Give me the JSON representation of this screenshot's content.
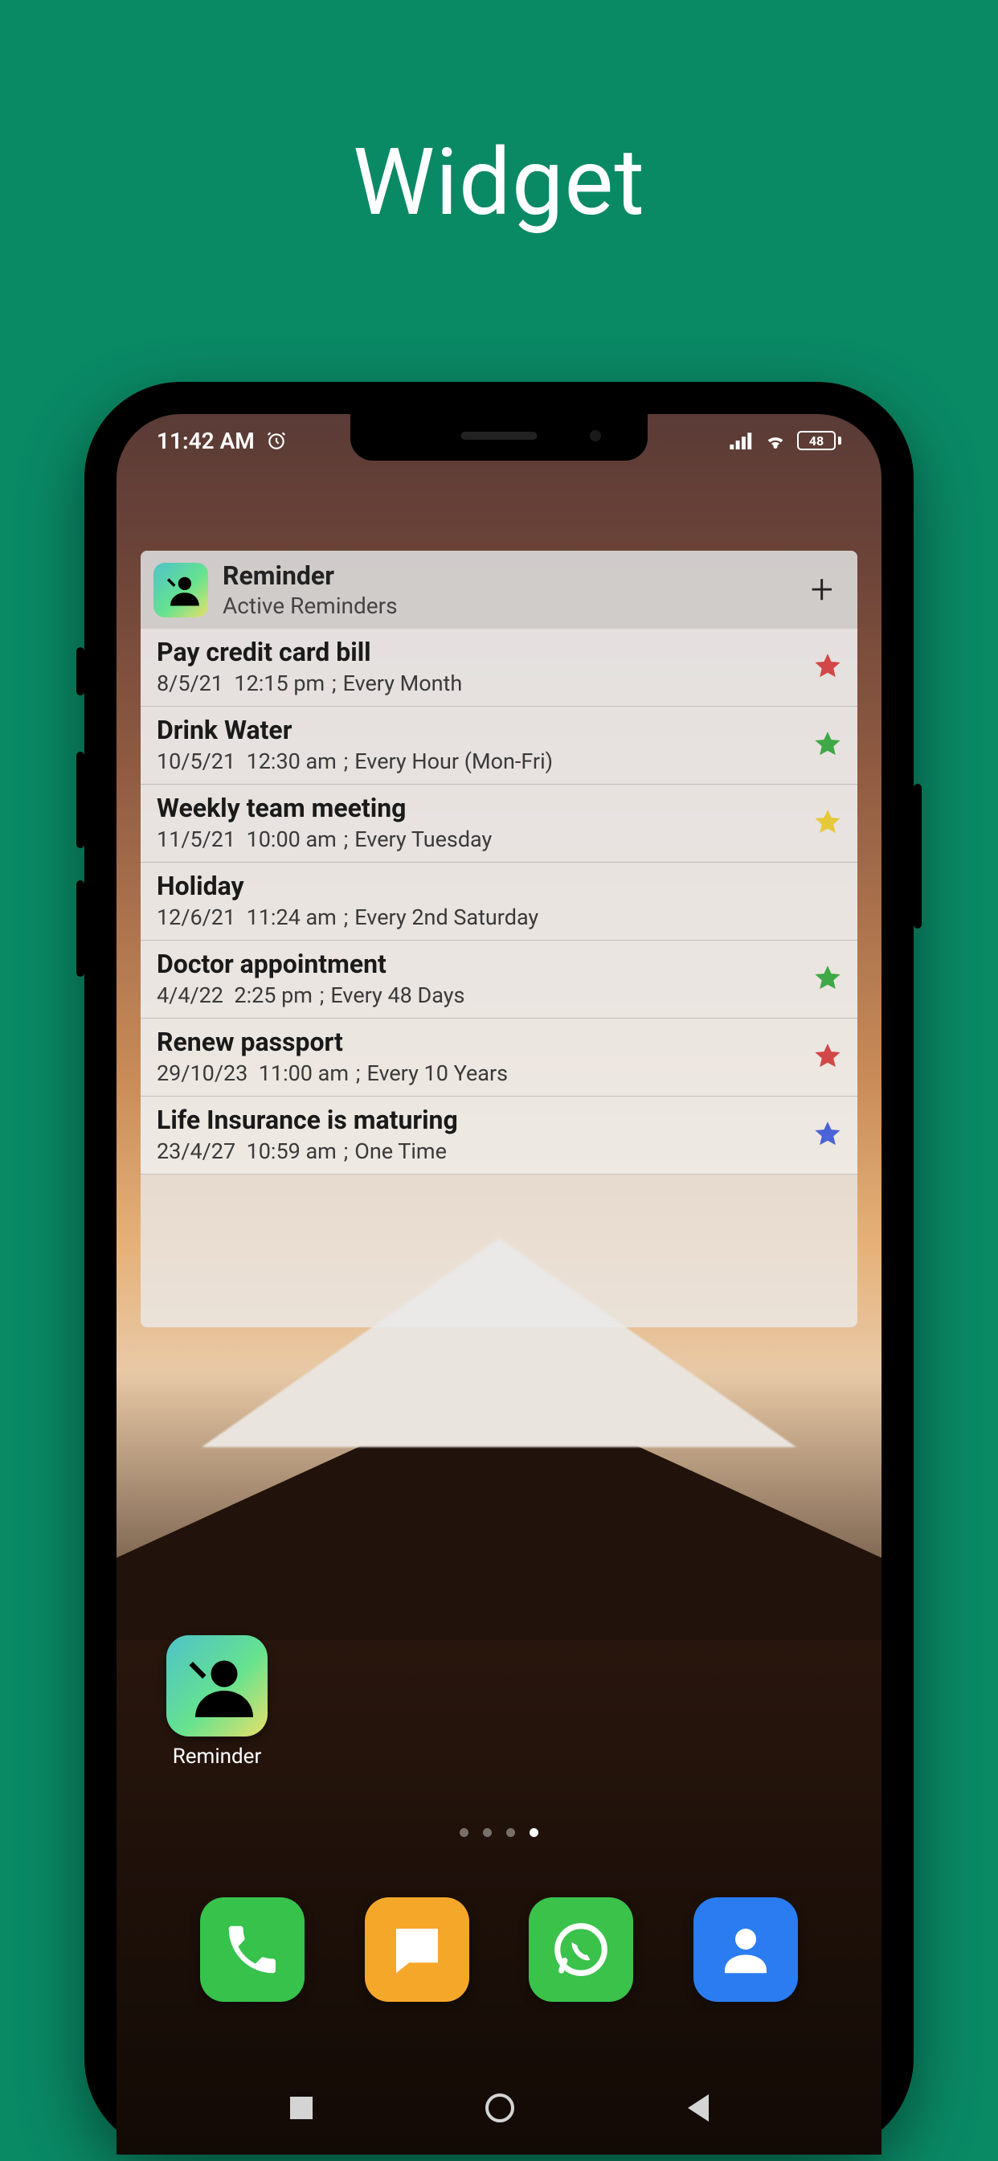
{
  "page": {
    "title": "Widget"
  },
  "status": {
    "time": "11:42 AM",
    "battery": "48"
  },
  "widget": {
    "app_name": "Reminder",
    "subtitle": "Active Reminders",
    "items": [
      {
        "title": "Pay credit card bill",
        "date": "8/5/21",
        "time": "12:15 pm",
        "repeat": "Every Month",
        "star": "#d24747"
      },
      {
        "title": "Drink Water",
        "date": "10/5/21",
        "time": "12:30 am",
        "repeat": "Every Hour (Mon-Fri)",
        "star": "#3fa847"
      },
      {
        "title": "Weekly team meeting",
        "date": "11/5/21",
        "time": "10:00 am",
        "repeat": "Every Tuesday",
        "star": "#e6c93a"
      },
      {
        "title": "Holiday",
        "date": "12/6/21",
        "time": "11:24 am",
        "repeat": "Every 2nd Saturday",
        "star": ""
      },
      {
        "title": "Doctor appointment",
        "date": "4/4/22",
        "time": "2:25 pm",
        "repeat": "Every 48 Days",
        "star": "#3fa847"
      },
      {
        "title": "Renew passport",
        "date": "29/10/23",
        "time": "11:00 am",
        "repeat": "Every 10 Years",
        "star": "#d24747"
      },
      {
        "title": "Life Insurance is maturing",
        "date": "23/4/27",
        "time": "10:59 am",
        "repeat": "One Time",
        "star": "#4a63d6"
      }
    ]
  },
  "home_app": {
    "label": "Reminder"
  },
  "dock": {
    "phone": "Phone",
    "messages": "Messages",
    "whatsapp": "WhatsApp",
    "contacts": "Contacts"
  },
  "pager": {
    "count": 4,
    "active_index": 3
  }
}
